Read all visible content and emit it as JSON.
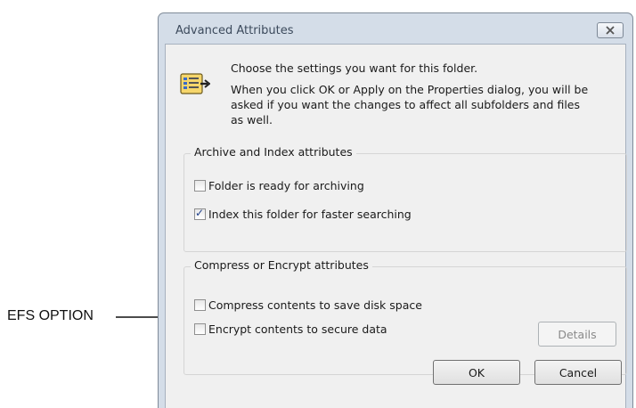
{
  "annotation": {
    "label": "EFS OPTION"
  },
  "dialog": {
    "title": "Advanced Attributes",
    "close_icon": "close-icon",
    "info": {
      "heading": "Choose the settings you want for this folder.",
      "line1": "When you click OK or Apply on the Properties dialog, you will be",
      "line2": "asked if you want the changes to affect all subfolders and files",
      "line3": "as well."
    },
    "archive_group": {
      "label": "Archive and Index attributes",
      "items": [
        {
          "label": "Folder is ready for archiving",
          "checked": false
        },
        {
          "label": "Index this folder for faster searching",
          "checked": true
        }
      ]
    },
    "compress_group": {
      "label": "Compress or Encrypt attributes",
      "items": [
        {
          "label": "Compress contents to save disk space",
          "checked": false
        },
        {
          "label": "Encrypt contents to secure data",
          "checked": false
        }
      ],
      "details_label": "Details"
    },
    "buttons": {
      "ok": "OK",
      "cancel": "Cancel"
    }
  }
}
